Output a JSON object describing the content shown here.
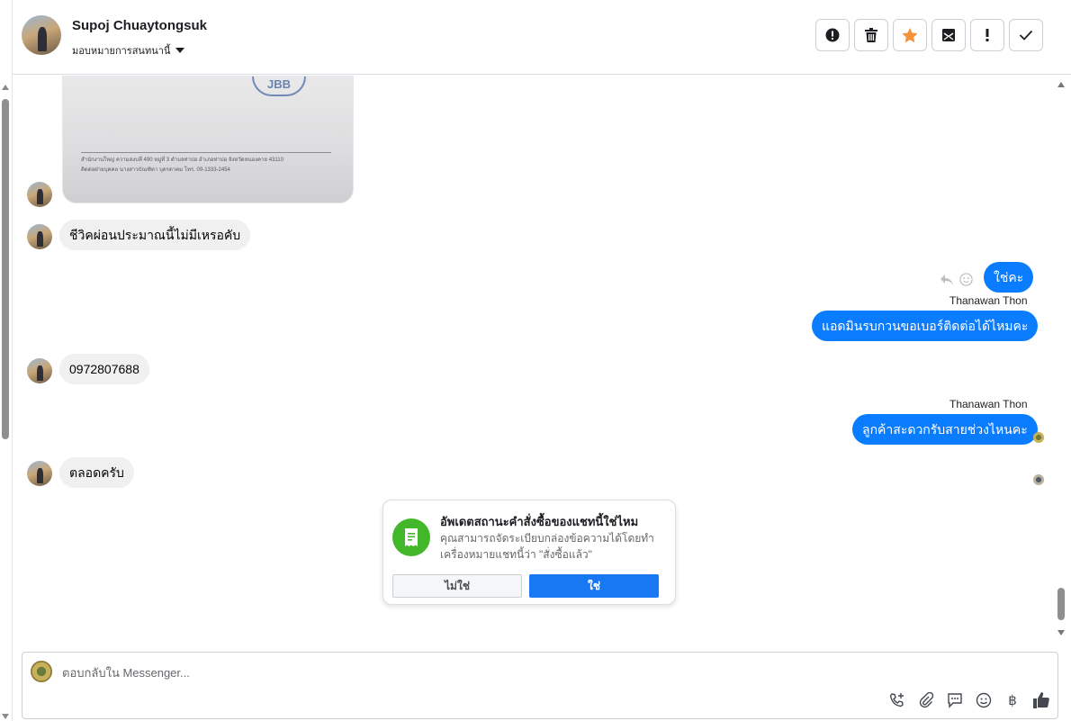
{
  "header": {
    "contact_name": "Supoj Chuaytongsuk",
    "assign_label": "มอบหมายการสนทนานี้",
    "actions": [
      {
        "name": "spam-button",
        "icon": "alert-circle-icon"
      },
      {
        "name": "delete-button",
        "icon": "trash-icon"
      },
      {
        "name": "star-button",
        "icon": "star-icon"
      },
      {
        "name": "mark-unread-button",
        "icon": "envelope-icon"
      },
      {
        "name": "follow-up-button",
        "icon": "exclamation-icon"
      },
      {
        "name": "done-button",
        "icon": "checkmark-icon"
      }
    ],
    "star_color": "#f7923b"
  },
  "image_doc": {
    "stamp": "JBB",
    "line1": "สำนักงานใหญ่ ความสงบที่ 490 หมู่ที่ 3 ตำบลท่าบ่อ อำเภอท่าบ่อ จังหวัดหนองคาย 43110",
    "line2": "ติดต่อฝ่ายบุคคล นางสาวบัณฑิตา บุตรตาคม โทร. 09-1333-2454"
  },
  "messages": {
    "in1": "ชีวิคผ่อนประมาณนี้ไม่มีเหรอคับ",
    "out1": "ใช่คะ",
    "out1_sender": "Thanawan Thon",
    "out2": "แอดมินรบกวนขอเบอร์ติดต่อได้ไหมคะ",
    "in2": "0972807688",
    "out3_sender": "Thanawan Thon",
    "out3": "ลูกค้าสะดวกรับสายช่วงไหนคะ",
    "in3": "ตลอดครับ"
  },
  "order_card": {
    "title": "อัพเดตสถานะคำสั่งซื้อของแชทนี้ใช่ไหม",
    "description": "คุณสามารถจัดระเบียบกล่องข้อความได้โดยทำเครื่องหมายแชทนี้ว่า \"สั่งซื้อแล้ว\"",
    "no_label": "ไม่ใช่",
    "yes_label": "ใช่",
    "icon": "receipt-icon",
    "icon_color": "#42b72a"
  },
  "composer": {
    "placeholder": "ตอบกลับใน Messenger...",
    "tools": [
      "add-call-icon",
      "attachment-icon",
      "saved-replies-icon",
      "emoji-icon",
      "baht-icon",
      "thumbs-up-icon"
    ]
  },
  "colors": {
    "outgoing": "#0a7cff",
    "incoming": "#f0f0f0",
    "primary_button": "#1877f2"
  }
}
